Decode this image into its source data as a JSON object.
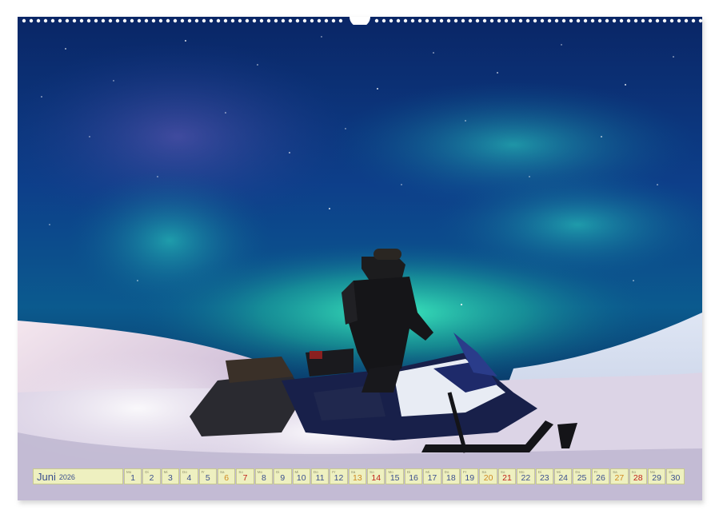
{
  "calendar": {
    "month": "Juni",
    "year": "2026",
    "days": [
      {
        "d": "1",
        "wd": "Mo",
        "type": "weekday"
      },
      {
        "d": "2",
        "wd": "Di",
        "type": "weekday"
      },
      {
        "d": "3",
        "wd": "Mi",
        "type": "weekday"
      },
      {
        "d": "4",
        "wd": "Do",
        "type": "weekday"
      },
      {
        "d": "5",
        "wd": "Fr",
        "type": "weekday"
      },
      {
        "d": "6",
        "wd": "Sa",
        "type": "sat"
      },
      {
        "d": "7",
        "wd": "So",
        "type": "sun"
      },
      {
        "d": "8",
        "wd": "Mo",
        "type": "weekday"
      },
      {
        "d": "9",
        "wd": "Di",
        "type": "weekday"
      },
      {
        "d": "10",
        "wd": "Mi",
        "type": "weekday"
      },
      {
        "d": "11",
        "wd": "Do",
        "type": "weekday"
      },
      {
        "d": "12",
        "wd": "Fr",
        "type": "weekday"
      },
      {
        "d": "13",
        "wd": "Sa",
        "type": "sat"
      },
      {
        "d": "14",
        "wd": "So",
        "type": "sun"
      },
      {
        "d": "15",
        "wd": "Mo",
        "type": "weekday"
      },
      {
        "d": "16",
        "wd": "Di",
        "type": "weekday"
      },
      {
        "d": "17",
        "wd": "Mi",
        "type": "weekday"
      },
      {
        "d": "18",
        "wd": "Do",
        "type": "weekday"
      },
      {
        "d": "19",
        "wd": "Fr",
        "type": "weekday"
      },
      {
        "d": "20",
        "wd": "Sa",
        "type": "sat"
      },
      {
        "d": "21",
        "wd": "So",
        "type": "sun"
      },
      {
        "d": "22",
        "wd": "Mo",
        "type": "weekday"
      },
      {
        "d": "23",
        "wd": "Di",
        "type": "weekday"
      },
      {
        "d": "24",
        "wd": "Mi",
        "type": "weekday"
      },
      {
        "d": "25",
        "wd": "Do",
        "type": "weekday"
      },
      {
        "d": "26",
        "wd": "Fr",
        "type": "weekday"
      },
      {
        "d": "27",
        "wd": "Sa",
        "type": "sat"
      },
      {
        "d": "28",
        "wd": "So",
        "type": "sun"
      },
      {
        "d": "29",
        "wd": "Mo",
        "type": "weekday"
      },
      {
        "d": "30",
        "wd": "Di",
        "type": "weekday"
      }
    ]
  },
  "colors": {
    "sky_top": "#0a2a70",
    "aurora": "#2fe0b0",
    "snow": "#e8ecf5",
    "strip_bg": "#eef0c0",
    "weekday_text": "#3b4f8e",
    "saturday_text": "#d08a20",
    "sunday_text": "#c0201a"
  },
  "photo": {
    "subject": "snowmobile-rider",
    "icons": [
      "spiral-binding-icon",
      "hanger-notch-icon"
    ]
  }
}
